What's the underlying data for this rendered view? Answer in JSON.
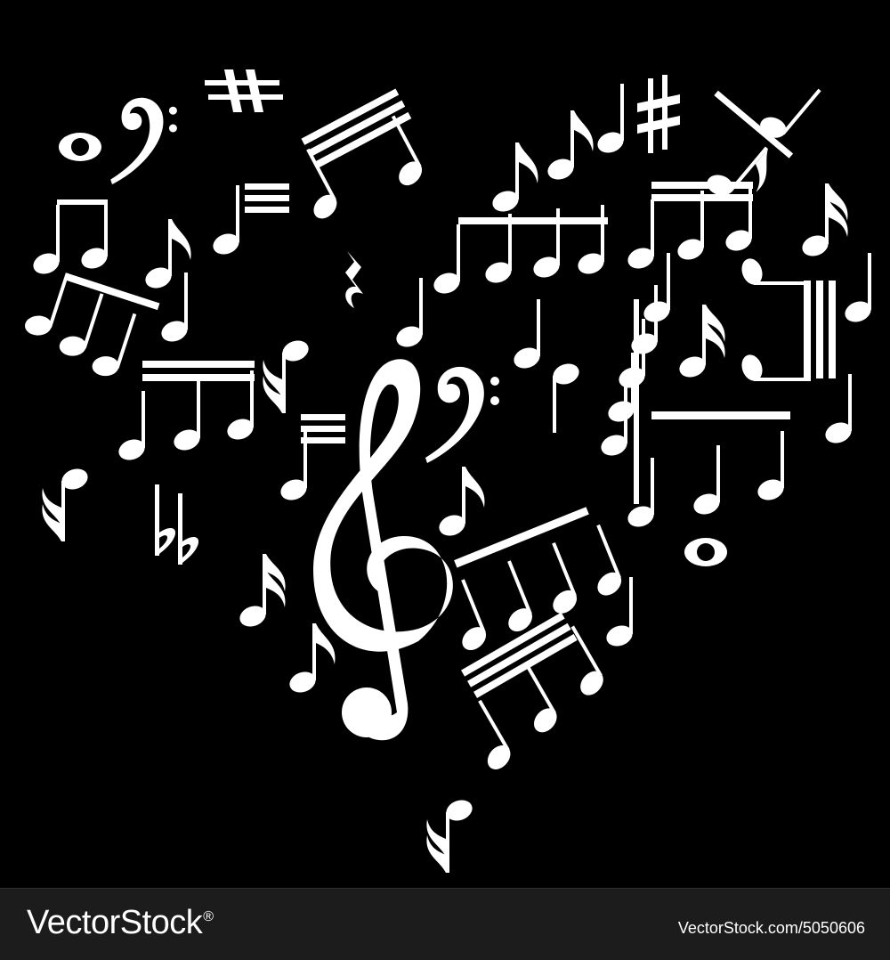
{
  "illustration": {
    "motif": "heart-of-music-notes",
    "colors": {
      "background": "#000000",
      "notes": "#ffffff",
      "footer": "#1c1c1c"
    },
    "glyphs": [
      "treble-clef-icon",
      "bass-clef-icon",
      "sharp-icon",
      "flat-icon",
      "natural-icon",
      "whole-note-icon",
      "quarter-note-icon",
      "eighth-note-icon",
      "sixteenth-note-icon",
      "beamed-notes-icon",
      "quarter-rest-icon"
    ]
  },
  "footer": {
    "brand": "VectorStock",
    "trademark": "®",
    "attribution": "VectorStock.com/5050606"
  }
}
